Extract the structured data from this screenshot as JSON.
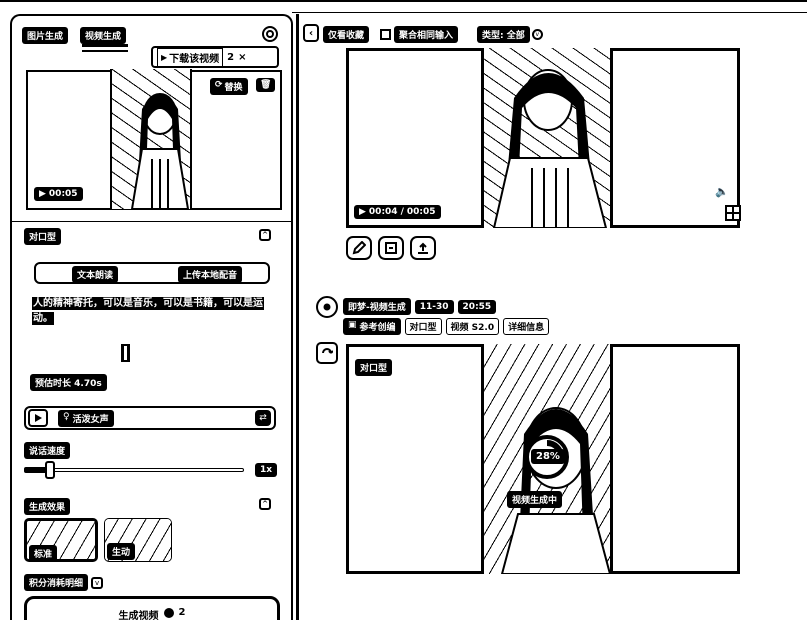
{
  "left": {
    "tabs": {
      "image_gen": "图片生成",
      "video_gen": "视频生成"
    },
    "download_popup": {
      "label": "下载该视频",
      "badge": "2",
      "close": "×"
    },
    "preview": {
      "time": "00:05",
      "replace_label": "替换"
    },
    "lipsync_section": {
      "title": "对口型",
      "tab_text": "文本朗读",
      "tab_upload": "上传本地配音"
    },
    "script_text": "人的精神寄托，可以是音乐，可以是书籍，可以是运动。",
    "duration": "预估时长 4.70s",
    "voice": {
      "name": "活泼女声"
    },
    "speed": {
      "label": "说话速度",
      "value": "1x",
      "level": 0.12
    },
    "effect": {
      "title": "生成效果",
      "options": [
        {
          "label": "标准"
        },
        {
          "label": "生动"
        }
      ]
    },
    "credits_label": "积分消耗明细",
    "generate": {
      "label": "生成视频",
      "cost": "2"
    }
  },
  "right": {
    "filters": {
      "favorites": "仅看收藏",
      "aggregate": "聚合相同输入",
      "type": "类型: 全部"
    },
    "video1": {
      "time_current": "00:04",
      "time_sep": "/",
      "time_total": "00:05"
    },
    "job2": {
      "source": "即梦-视频生成",
      "date": "11-30",
      "time": "20:55",
      "ref": "参考创编",
      "mode": "对口型",
      "model": "视频 S2.0",
      "details": "详细信息"
    },
    "video2": {
      "label": "对口型",
      "progress": "28%",
      "progress_value": 0.28,
      "status": "视频生成中"
    }
  },
  "colors": {
    "ink": "#000000",
    "paper": "#ffffff"
  }
}
